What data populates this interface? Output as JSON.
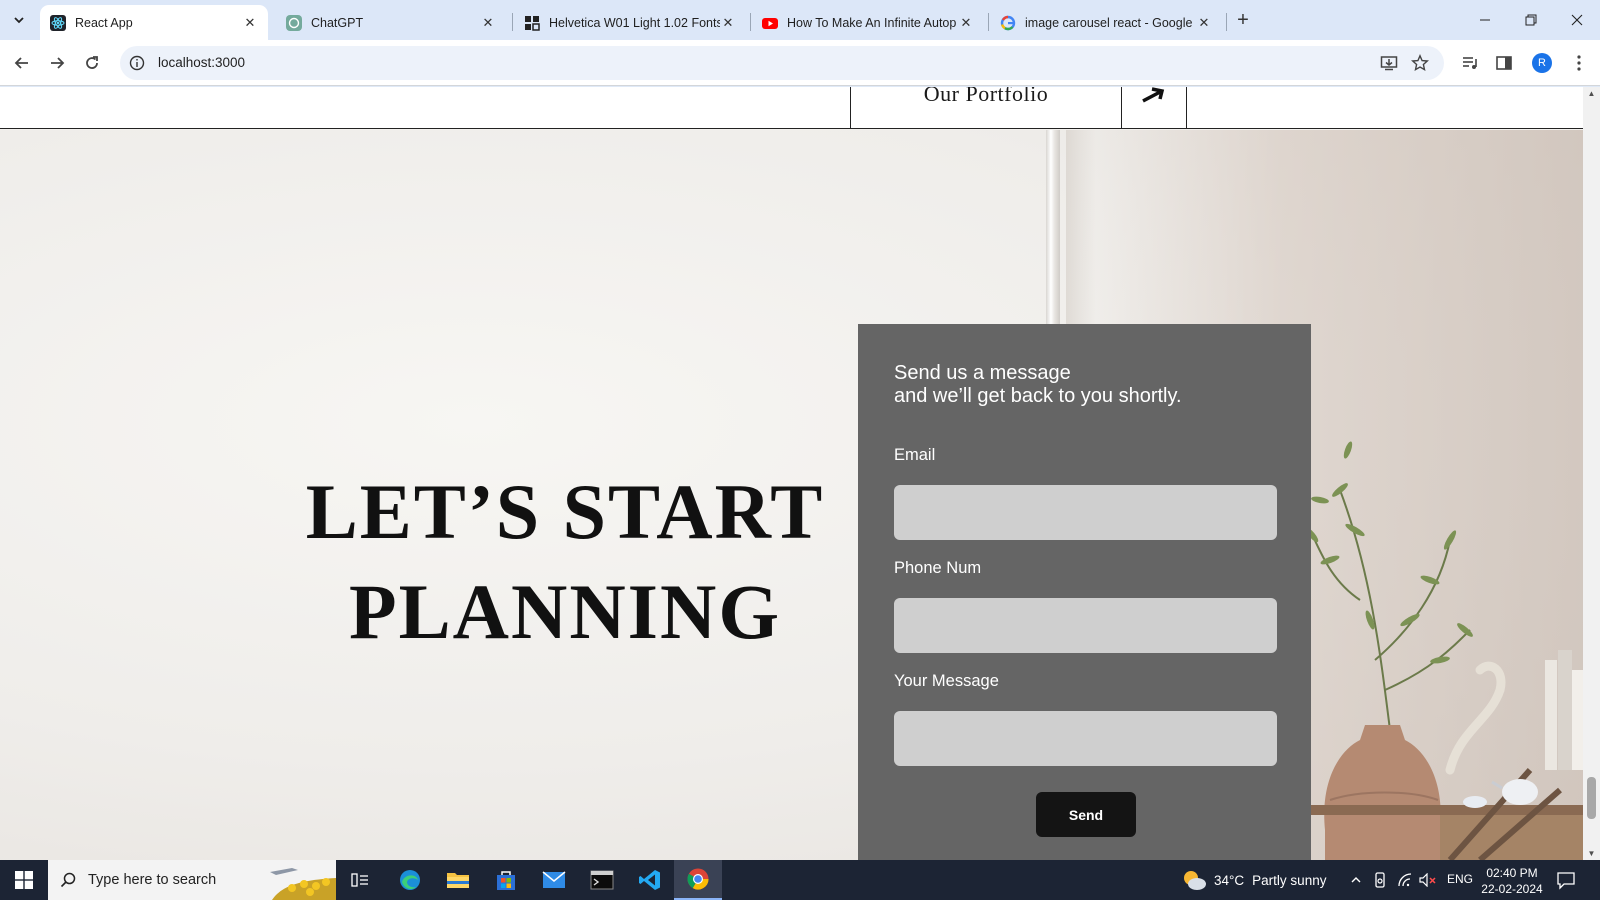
{
  "browser": {
    "tabs": [
      {
        "label": "React App",
        "icon": "react-icon",
        "active": true
      },
      {
        "label": "ChatGPT",
        "icon": "chatgpt-icon",
        "active": false
      },
      {
        "label": "Helvetica W01 Light 1.02 Fonts",
        "icon": "fonts-site-icon",
        "active": false
      },
      {
        "label": "How To Make An Infinite Autop",
        "icon": "youtube-icon",
        "active": false
      },
      {
        "label": "image carousel react - Google S",
        "icon": "google-icon",
        "active": false
      }
    ],
    "url": "localhost:3000",
    "profile_initial": "R"
  },
  "site": {
    "nav_portfolio": "Our Portfolio",
    "nav_arrow": "➔",
    "headline_line1": "LET’S START",
    "headline_line2": "PLANNING",
    "form": {
      "intro_line1": "Send us a message",
      "intro_line2": "and we’ll get back to you shortly.",
      "email_label": "Email",
      "phone_label": "Phone Num",
      "message_label": "Your Message",
      "email_value": "",
      "phone_value": "",
      "message_value": "",
      "send_label": "Send"
    }
  },
  "taskbar": {
    "search_placeholder": "Type here to search",
    "weather_temp": "34°C",
    "weather_text": "Partly sunny",
    "language": "ENG",
    "time": "02:40 PM",
    "date": "22-02-2024"
  },
  "colors": {
    "form_panel": "#656565",
    "input_fill": "#cfcfcf",
    "send_button": "#141414",
    "taskbar": "#1c2434",
    "tabstrip": "#dce7f8"
  }
}
